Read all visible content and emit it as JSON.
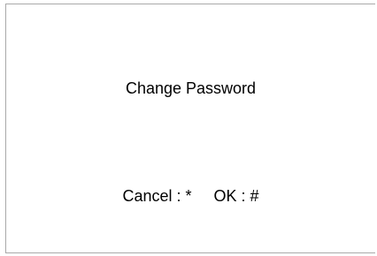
{
  "screen": {
    "title": "Change Password",
    "cancel_hint": "Cancel : *",
    "ok_hint": "OK : #"
  }
}
